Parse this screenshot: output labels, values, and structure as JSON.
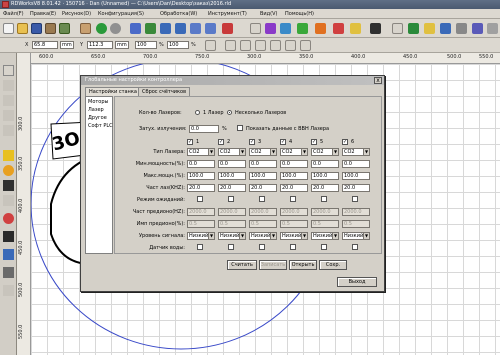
{
  "window": {
    "title": "RDWorksV8 8.01.42 · 150716 · Dan (Unnamed) — C:\\Users\\Dan\\Desktop\\заказ\\2016.rld"
  },
  "menu": [
    "Файл(F)",
    "Правка(E)",
    "Рисунок(D)",
    "Конфигурация(S)",
    "Обработка(W)",
    "Инструмент(T)",
    "Вид(V)",
    "Помощь(H)"
  ],
  "coords": {
    "x_label": "X",
    "x_value": "65.8",
    "y_label": "Y",
    "y_value": "112.3",
    "w_value": "mm",
    "h_value": "mm",
    "pct1": "100",
    "pct2": "100",
    "unit": "%"
  },
  "hruler": [
    "600.0",
    "650.0",
    "700.0",
    "750.0",
    "300.0",
    "350.0",
    "400.0",
    "450.0",
    "500.0",
    "550.0"
  ],
  "vruler": [
    "300.0",
    "350.0",
    "400.0",
    "450.0",
    "500.0",
    "550.0"
  ],
  "dialog": {
    "title": "Глобальные настройки контроллера",
    "close": "x",
    "tabs": [
      "Настройки станка",
      "Сброс счётчиков"
    ],
    "nav": [
      "Моторы",
      "Лазер",
      "Другое",
      "Софт PLC"
    ],
    "laser_count_label": "Кол-во Лазеров:",
    "laser_single": "1 Лазер",
    "laser_multi": "Несколько Лазеров",
    "attenuation_label": "Затух. излучения:",
    "attenuation_value": "0.0",
    "attenuation_unit": "%",
    "show_data_label": "Показать данные с ВВН Лазера",
    "columns": [
      "1",
      "2",
      "3",
      "4",
      "5",
      "6"
    ],
    "rows": {
      "type_label": "Тип Лазера:",
      "type_values": [
        "CO2",
        "CO2",
        "CO2",
        "CO2",
        "CO2",
        "CO2"
      ],
      "minpow_label": "Мин.мощность(%):",
      "minpow_values": [
        "0.0",
        "0.0",
        "0.0",
        "0.0",
        "0.0",
        "0.0"
      ],
      "maxpow_label": "Макс.мощн.(%):",
      "maxpow_values": [
        "100.0",
        "100.0",
        "100.0",
        "100.0",
        "100.0",
        "100.0"
      ],
      "freq_label": "Част лаз(KHZ):",
      "freq_values": [
        "20.0",
        "20.0",
        "20.0",
        "20.0",
        "20.0",
        "20.0"
      ],
      "standby_label": "Режим ожиданий:",
      "prefreq_label": "Част предионо(HZ):",
      "prefreq_values": [
        "2000.0",
        "2000.0",
        "2000.0",
        "2000.0",
        "2000.0",
        "2000.0"
      ],
      "preimp_label": "Имп предионо(%):",
      "preimp_values": [
        "0.5",
        "0.5",
        "0.5",
        "0.5",
        "0.5",
        "0.5"
      ],
      "level_label": "Уровень сигнала:",
      "level_values": [
        "Низкий",
        "Низкий",
        "Низкий",
        "Низкий",
        "Низкий",
        "Низкий"
      ],
      "water_label": "Датчик воды:"
    },
    "buttons": {
      "read": "Считать",
      "write": "Записать",
      "open": "Открыть",
      "save": "Сохр.",
      "exit": "Выход"
    }
  },
  "colors": {
    "titlebar": "#4b5a70",
    "dialog_bg": "#d4d0c8",
    "canvas_bg": "#ffffff"
  }
}
